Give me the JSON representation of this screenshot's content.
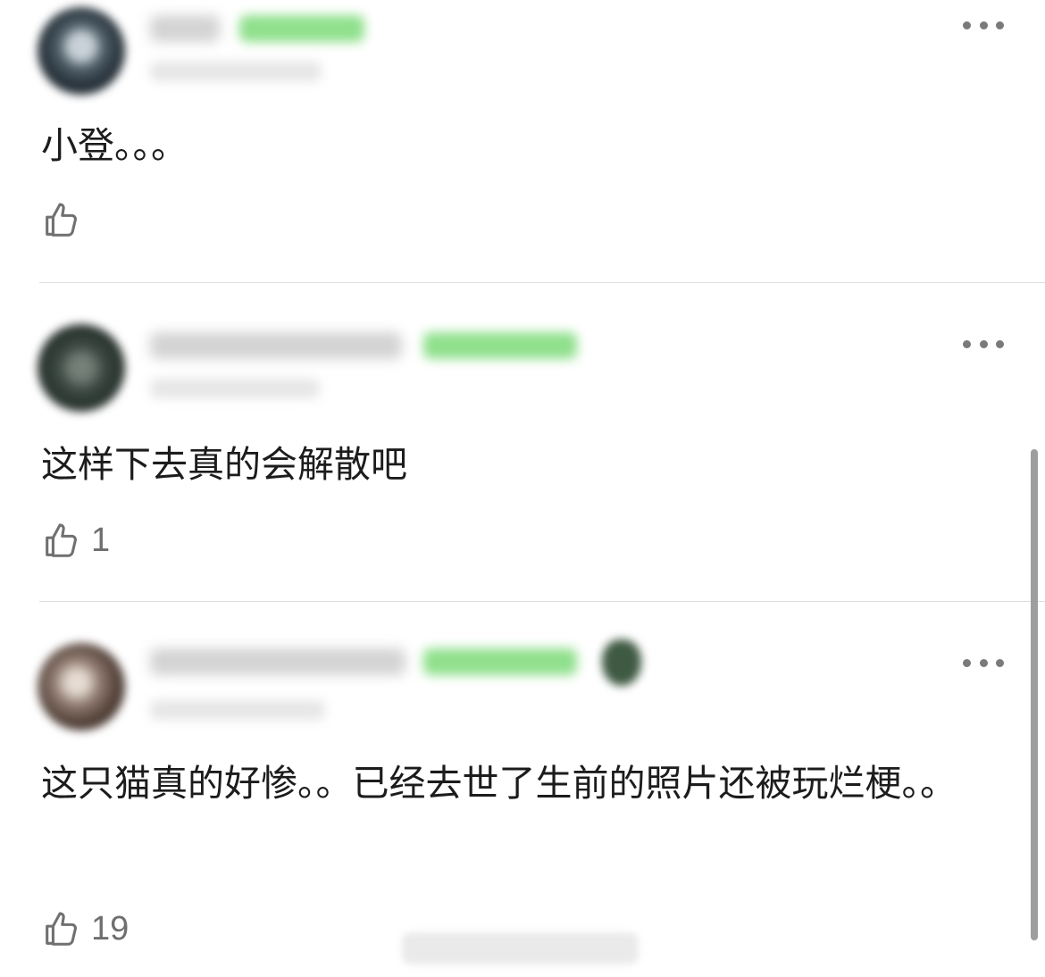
{
  "comments": [
    {
      "text": "小登。。。",
      "likes": "",
      "more_label": "more-options"
    },
    {
      "text": "这样下去真的会解散吧",
      "likes": "1",
      "more_label": "more-options"
    },
    {
      "text": "这只猫真的好惨。。已经去世了生前的照片还被玩烂梗。。",
      "likes": "19",
      "more_label": "more-options"
    }
  ],
  "icons": {
    "like": "thumbs-up-icon",
    "more": "more-horizontal-icon"
  },
  "colors": {
    "badge_green": "#8fe08c",
    "text": "#1c1c1c",
    "muted": "#6f6f6f",
    "divider": "#dedede"
  }
}
